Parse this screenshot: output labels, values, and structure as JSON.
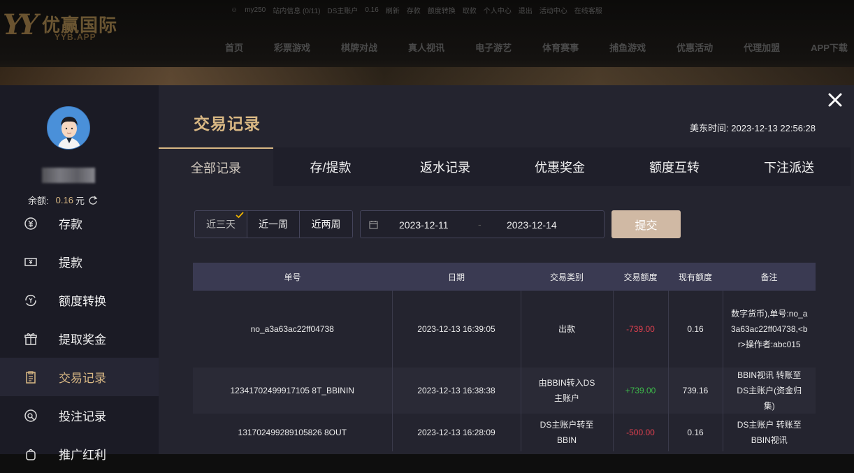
{
  "site": {
    "logo_mark": "YY",
    "logo_cn": "优赢国际",
    "logo_en": "YYB.APP",
    "topbar": [
      "my250",
      "站内信息 (0/11)",
      "DS主账户",
      "0.16",
      "刷新",
      "存款",
      "额度转换",
      "取款",
      "个人中心",
      "退出",
      "活动中心",
      "在线客服"
    ],
    "nav": [
      "首页",
      "彩票游戏",
      "棋牌对战",
      "真人视讯",
      "电子游艺",
      "体育赛事",
      "捕鱼游戏",
      "优惠活动",
      "代理加盟",
      "APP下载"
    ]
  },
  "sidebar": {
    "balance_label": "余额:",
    "balance_value": "0.16",
    "balance_unit": "元",
    "items": [
      {
        "label": "存款",
        "icon": "deposit-icon"
      },
      {
        "label": "提款",
        "icon": "withdraw-icon"
      },
      {
        "label": "额度转换",
        "icon": "transfer-icon"
      },
      {
        "label": "提取奖金",
        "icon": "gift-icon"
      },
      {
        "label": "交易记录",
        "icon": "clipboard-icon"
      },
      {
        "label": "投注记录",
        "icon": "bet-record-icon"
      },
      {
        "label": "推广红利",
        "icon": "promo-icon"
      }
    ]
  },
  "main": {
    "title": "交易记录",
    "time_label": "美东时间:",
    "time_value": "2023-12-13 22:56:28",
    "tabs": [
      "全部记录",
      "存/提款",
      "返水记录",
      "优惠奖金",
      "额度互转",
      "下注派送"
    ],
    "filter": {
      "ranges": [
        "近三天",
        "近一周",
        "近两周"
      ],
      "start_date": "2023-12-11",
      "separator": "-",
      "end_date": "2023-12-14",
      "submit_label": "提交"
    },
    "table": {
      "headers": [
        "单号",
        "日期",
        "交易类别",
        "交易额度",
        "现有额度",
        "备注"
      ],
      "rows": [
        {
          "id": "no_a3a63ac22ff04738",
          "date": "2023-12-13 16:39:05",
          "type": "出款",
          "amount": "-739.00",
          "balance": "0.16",
          "note": "数字货币),单号:no_a3a63ac22ff04738,<br>操作者:abc015"
        },
        {
          "id": "12341702499917105 8T_BBININ",
          "date": "2023-12-13 16:38:38",
          "type": "由BBIN转入DS主账户",
          "amount": "+739.00",
          "balance": "739.16",
          "note": "BBIN视讯 转账至 DS主账户(资金归集)"
        },
        {
          "id": "131702499289105826 8OUT",
          "date": "2023-12-13 16:28:09",
          "type": "DS主账户转至BBIN",
          "amount": "-500.00",
          "balance": "0.16",
          "note": "DS主账户 转账至 BBIN视讯"
        }
      ]
    }
  },
  "colors": {
    "accent": "#d9b884",
    "negative": "#e0404f",
    "positive": "#3dbb4a"
  }
}
